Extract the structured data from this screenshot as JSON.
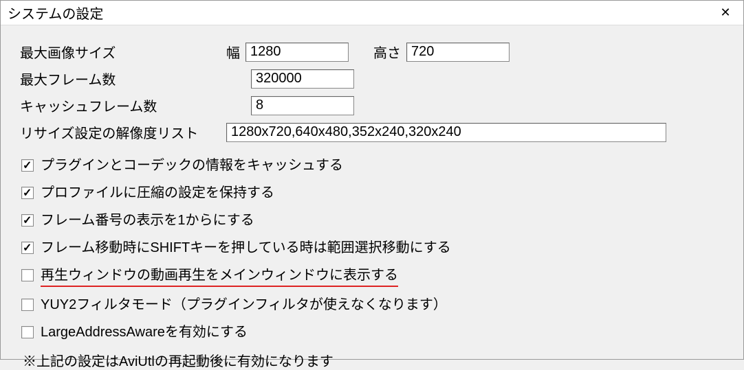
{
  "window": {
    "title": "システムの設定"
  },
  "fields": {
    "max_image_size_label": "最大画像サイズ",
    "width_label": "幅",
    "width_value": "1280",
    "height_label": "高さ",
    "height_value": "720",
    "max_frames_label": "最大フレーム数",
    "max_frames_value": "320000",
    "cache_frames_label": "キャッシュフレーム数",
    "cache_frames_value": "8",
    "resize_list_label": "リサイズ設定の解像度リスト",
    "resize_list_value": "1280x720,640x480,352x240,320x240"
  },
  "checks": {
    "cache_plugin": {
      "checked": true,
      "label": "プラグインとコーデックの情報をキャッシュする"
    },
    "keep_compress": {
      "checked": true,
      "label": "プロファイルに圧縮の設定を保持する"
    },
    "frame_from_one": {
      "checked": true,
      "label": "フレーム番号の表示を1からにする"
    },
    "shift_range": {
      "checked": true,
      "label": "フレーム移動時にSHIFTキーを押している時は範囲選択移動にする"
    },
    "play_in_main": {
      "checked": false,
      "label": "再生ウィンドウの動画再生をメインウィンドウに表示する"
    },
    "yuy2": {
      "checked": false,
      "label": "YUY2フィルタモード（プラグインフィルタが使えなくなります）"
    },
    "laa": {
      "checked": false,
      "label": "LargeAddressAwareを有効にする"
    }
  },
  "note": "※上記の設定はAviUtlの再起動後に有効になります"
}
